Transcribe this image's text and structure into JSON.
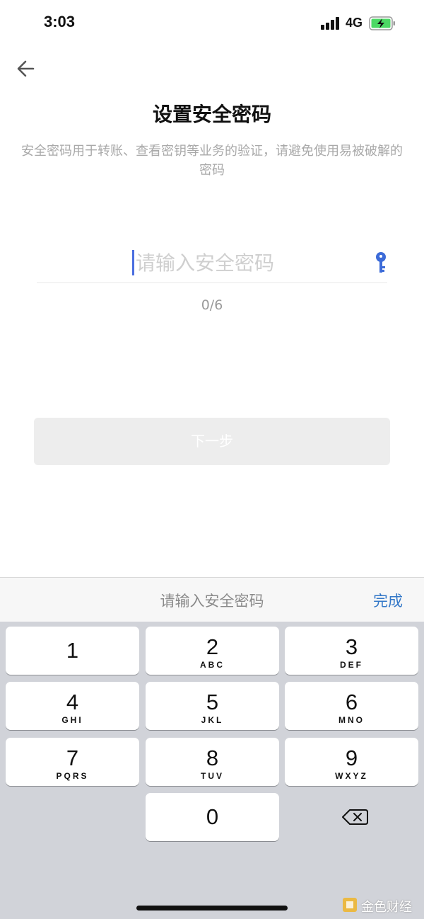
{
  "status_bar": {
    "time": "3:03",
    "network": "4G",
    "battery": "charging"
  },
  "header": {
    "back_icon": "back-arrow-icon",
    "title": "设置安全密码"
  },
  "description": "安全密码用于转账、查看密钥等业务的验证，请避免使用易被破解的密码",
  "password_input": {
    "placeholder": "请输入安全密码",
    "value": "",
    "toggle_icon": "key-icon"
  },
  "counter": "0/6",
  "next_button": {
    "label": "下一步",
    "enabled": false
  },
  "keyboard": {
    "hint": "请输入安全密码",
    "done_label": "完成",
    "keys": [
      {
        "num": "1",
        "letters": ""
      },
      {
        "num": "2",
        "letters": "ABC"
      },
      {
        "num": "3",
        "letters": "DEF"
      },
      {
        "num": "4",
        "letters": "GHI"
      },
      {
        "num": "5",
        "letters": "JKL"
      },
      {
        "num": "6",
        "letters": "MNO"
      },
      {
        "num": "7",
        "letters": "PQRS"
      },
      {
        "num": "8",
        "letters": "TUV"
      },
      {
        "num": "9",
        "letters": "WXYZ"
      },
      {
        "num": "0",
        "letters": ""
      }
    ],
    "delete_icon": "backspace-icon"
  },
  "watermark": "金色财经",
  "colors": {
    "accent": "#3478c8",
    "cursor": "#4a6ee0",
    "disabled_button": "#ededed",
    "keyboard_bg": "#d1d3d9"
  }
}
